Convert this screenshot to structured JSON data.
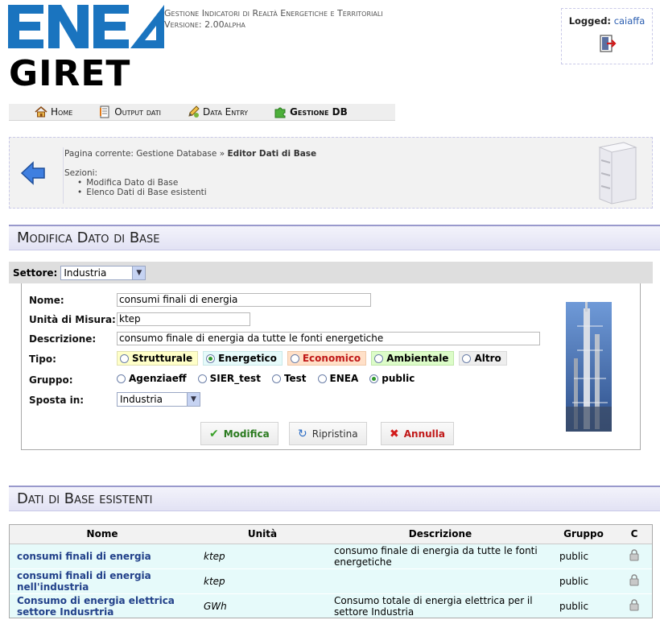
{
  "header": {
    "logo_text": "ENEA",
    "app_name": "GIRET",
    "title": "Gestione Indicatori di Realtà Energetiche e Territoriali",
    "version": "Versione: 2.00alpha",
    "logged_label": "Logged:",
    "user": "caiaffa",
    "logout_icon": "logout-door-icon"
  },
  "menu": [
    {
      "label": "Home",
      "icon": "home-icon"
    },
    {
      "label": "Output dati",
      "icon": "document-icon"
    },
    {
      "label": "Data Entry",
      "icon": "pencil-icon"
    },
    {
      "label": "Gestione DB",
      "icon": "puzzle-icon"
    }
  ],
  "breadcrumb": {
    "prefix": "Pagina corrente: Gestione Database",
    "separator": "»",
    "current": "Editor Dati di Base",
    "sections_label": "Sezioni:",
    "sections": [
      "Modifica Dato di Base",
      "Elenco Dati di Base esistenti"
    ]
  },
  "edit_section": {
    "title": "Modifica Dato di Base",
    "settore_label": "Settore:",
    "settore_value": "Industria"
  },
  "form": {
    "nome_label": "Nome:",
    "nome_value": "consumi finali di energia",
    "unita_label": "Unità di Misura:",
    "unita_value": "ktep",
    "descrizione_label": "Descrizione:",
    "descrizione_value": "consumo finale di energia da tutte le fonti energetiche",
    "tipo_label": "Tipo:",
    "tipo_options": [
      {
        "label": "Strutturale",
        "selected": false,
        "color": "#ffffc8"
      },
      {
        "label": "Energetico",
        "selected": true,
        "color": "#e6fafa"
      },
      {
        "label": "Economico",
        "selected": false,
        "color": "#ffe0c8"
      },
      {
        "label": "Ambientale",
        "selected": false,
        "color": "#dcfcc8"
      },
      {
        "label": "Altro",
        "selected": false,
        "color": "#eeeeee"
      }
    ],
    "gruppo_label": "Gruppo:",
    "gruppo_options": [
      {
        "label": "Agenziaeff",
        "selected": false
      },
      {
        "label": "SIER_test",
        "selected": false
      },
      {
        "label": "Test",
        "selected": false
      },
      {
        "label": "ENEA",
        "selected": false
      },
      {
        "label": "public",
        "selected": true
      }
    ],
    "sposta_label": "Sposta in:",
    "sposta_value": "Industria",
    "buttons": {
      "modifica": "Modifica",
      "ripristina": "Ripristina",
      "annulla": "Annulla"
    },
    "colors": {
      "modifica": "#2a7a1e",
      "ripristina": "#333333",
      "annulla": "#c01818"
    }
  },
  "list_section": {
    "title": "Dati di Base esistenti",
    "columns": [
      "Nome",
      "Unità",
      "Descrizione",
      "Gruppo",
      "C"
    ],
    "rows": [
      {
        "nome": "consumi finali di energia",
        "unita": "ktep",
        "descrizione": "consumo finale di energia da tutte le fonti energetiche",
        "gruppo": "public"
      },
      {
        "nome": "consumi finali di energia nell'industria",
        "unita": "ktep",
        "descrizione": "",
        "gruppo": "public"
      },
      {
        "nome": "Consumo di energia elettrica settore Indusrtria",
        "unita": "GWh",
        "descrizione": "Consumo totale di energia elettrica per il settore Industria",
        "gruppo": "public"
      }
    ]
  }
}
